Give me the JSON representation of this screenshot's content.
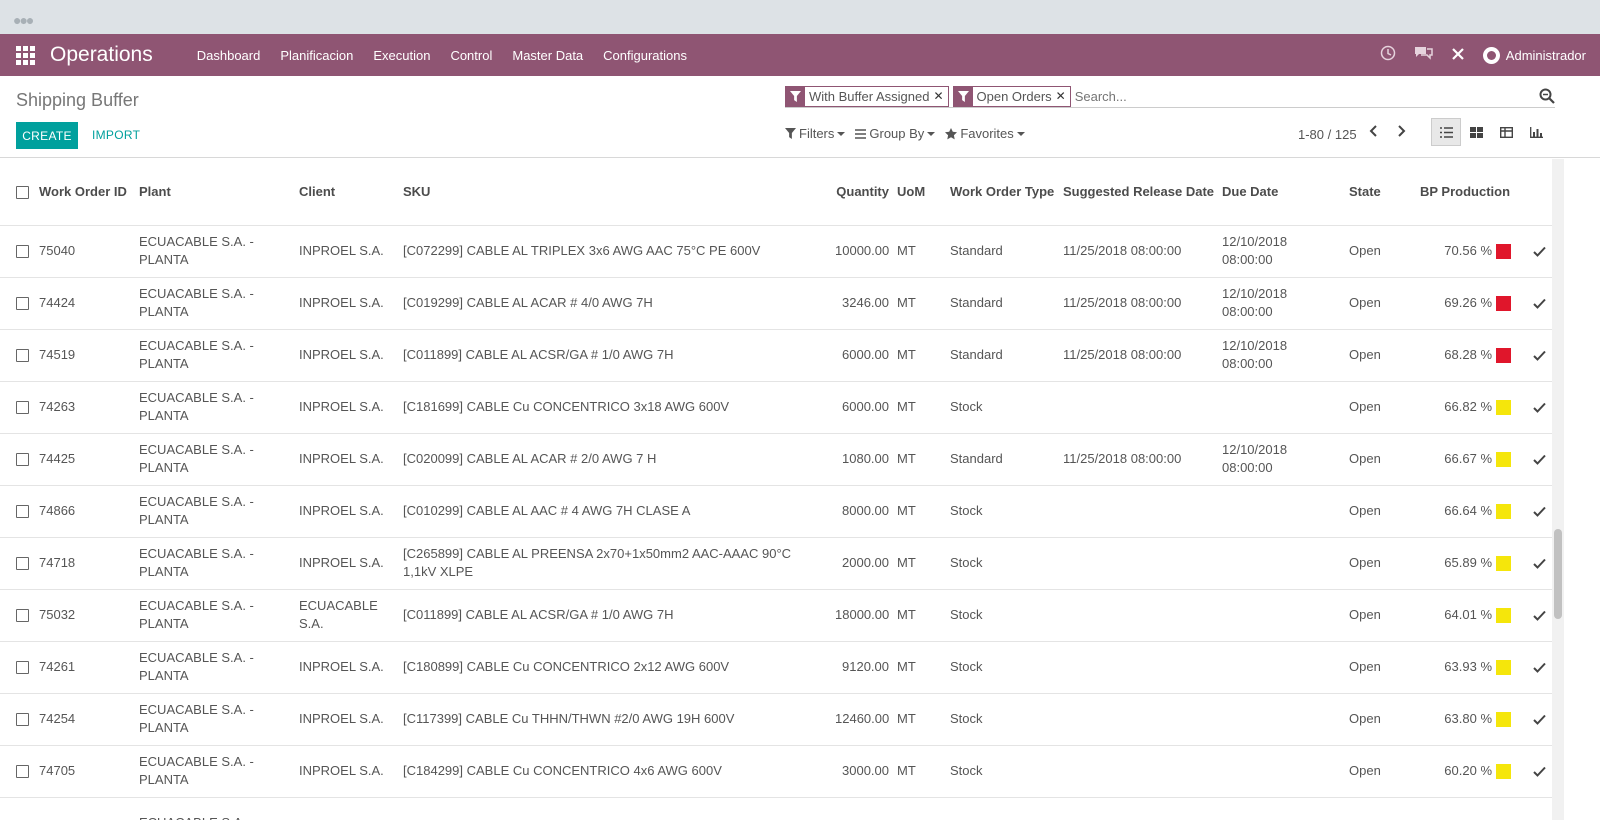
{
  "navbar": {
    "brand": "Operations",
    "menu": [
      "Dashboard",
      "Planificacion",
      "Execution",
      "Control",
      "Master Data",
      "Configurations"
    ],
    "user": "Administrador"
  },
  "cpanel": {
    "breadcrumb": "Shipping Buffer",
    "create_label": "CREATE",
    "import_label": "IMPORT",
    "facets": [
      "With Buffer Assigned",
      "Open Orders"
    ],
    "search_placeholder": "Search...",
    "filters_label": "Filters",
    "groupby_label": "Group By",
    "favorites_label": "Favorites",
    "pager": "1-80 / 125"
  },
  "table": {
    "headers": {
      "work_order_id": "Work Order ID",
      "plant": "Plant",
      "client": "Client",
      "sku": "SKU",
      "quantity": "Quantity",
      "uom": "UoM",
      "work_order_type": "Work Order Type",
      "suggested_release": "Suggested Release Date",
      "due_date": "Due Date",
      "state": "State",
      "bp_production": "BP Production"
    },
    "rows": [
      {
        "id": "75040",
        "plant": "ECUACABLE S.A. - PLANTA",
        "client": "INPROEL S.A.",
        "sku": "[C072299] CABLE AL TRIPLEX 3x6 AWG AAC 75°C PE 600V",
        "qty": "10000.00",
        "uom": "MT",
        "type": "Standard",
        "release": "11/25/2018 08:00:00",
        "due": "12/10/2018 08:00:00",
        "state": "Open",
        "bp": "70.56 %",
        "color": "#e0162b"
      },
      {
        "id": "74424",
        "plant": "ECUACABLE S.A. - PLANTA",
        "client": "INPROEL S.A.",
        "sku": "[C019299] CABLE AL ACAR # 4/0 AWG 7H",
        "qty": "3246.00",
        "uom": "MT",
        "type": "Standard",
        "release": "11/25/2018 08:00:00",
        "due": "12/10/2018 08:00:00",
        "state": "Open",
        "bp": "69.26 %",
        "color": "#e0162b"
      },
      {
        "id": "74519",
        "plant": "ECUACABLE S.A. - PLANTA",
        "client": "INPROEL S.A.",
        "sku": "[C011899] CABLE AL ACSR/GA # 1/0 AWG 7H",
        "qty": "6000.00",
        "uom": "MT",
        "type": "Standard",
        "release": "11/25/2018 08:00:00",
        "due": "12/10/2018 08:00:00",
        "state": "Open",
        "bp": "68.28 %",
        "color": "#e0162b"
      },
      {
        "id": "74263",
        "plant": "ECUACABLE S.A. - PLANTA",
        "client": "INPROEL S.A.",
        "sku": "[C181699] CABLE Cu CONCENTRICO 3x18 AWG 600V",
        "qty": "6000.00",
        "uom": "MT",
        "type": "Stock",
        "release": "",
        "due": "",
        "state": "Open",
        "bp": "66.82 %",
        "color": "#f5e60b"
      },
      {
        "id": "74425",
        "plant": "ECUACABLE S.A. - PLANTA",
        "client": "INPROEL S.A.",
        "sku": "[C020099] CABLE AL ACAR # 2/0 AWG 7 H",
        "qty": "1080.00",
        "uom": "MT",
        "type": "Standard",
        "release": "11/25/2018 08:00:00",
        "due": "12/10/2018 08:00:00",
        "state": "Open",
        "bp": "66.67 %",
        "color": "#f5e60b"
      },
      {
        "id": "74866",
        "plant": "ECUACABLE S.A. - PLANTA",
        "client": "INPROEL S.A.",
        "sku": "[C010299] CABLE AL AAC # 4 AWG 7H CLASE A",
        "qty": "8000.00",
        "uom": "MT",
        "type": "Stock",
        "release": "",
        "due": "",
        "state": "Open",
        "bp": "66.64 %",
        "color": "#f5e60b"
      },
      {
        "id": "74718",
        "plant": "ECUACABLE S.A. - PLANTA",
        "client": "INPROEL S.A.",
        "sku": "[C265899] CABLE AL PREENSA 2x70+1x50mm2 AAC-AAAC 90°C 1,1kV XLPE",
        "qty": "2000.00",
        "uom": "MT",
        "type": "Stock",
        "release": "",
        "due": "",
        "state": "Open",
        "bp": "65.89 %",
        "color": "#f5e60b"
      },
      {
        "id": "75032",
        "plant": "ECUACABLE S.A. - PLANTA",
        "client": "ECUACABLE S.A.",
        "sku": "[C011899] CABLE AL ACSR/GA # 1/0 AWG 7H",
        "qty": "18000.00",
        "uom": "MT",
        "type": "Stock",
        "release": "",
        "due": "",
        "state": "Open",
        "bp": "64.01 %",
        "color": "#f5e60b"
      },
      {
        "id": "74261",
        "plant": "ECUACABLE S.A. - PLANTA",
        "client": "INPROEL S.A.",
        "sku": "[C180899] CABLE Cu CONCENTRICO 2x12 AWG 600V",
        "qty": "9120.00",
        "uom": "MT",
        "type": "Stock",
        "release": "",
        "due": "",
        "state": "Open",
        "bp": "63.93 %",
        "color": "#f5e60b"
      },
      {
        "id": "74254",
        "plant": "ECUACABLE S.A. - PLANTA",
        "client": "INPROEL S.A.",
        "sku": "[C117399] CABLE Cu THHN/THWN #2/0 AWG 19H 600V",
        "qty": "12460.00",
        "uom": "MT",
        "type": "Stock",
        "release": "",
        "due": "",
        "state": "Open",
        "bp": "63.80 %",
        "color": "#f5e60b"
      },
      {
        "id": "74705",
        "plant": "ECUACABLE S.A. - PLANTA",
        "client": "INPROEL S.A.",
        "sku": "[C184299] CABLE Cu CONCENTRICO 4x6 AWG 600V",
        "qty": "3000.00",
        "uom": "MT",
        "type": "Stock",
        "release": "",
        "due": "",
        "state": "Open",
        "bp": "60.20 %",
        "color": "#f5e60b"
      },
      {
        "id": "",
        "plant": "ECUACABLE S.A.",
        "client": "",
        "sku": "",
        "qty": "",
        "uom": "",
        "type": "",
        "release": "",
        "due": "",
        "state": "",
        "bp": "",
        "color": ""
      }
    ]
  }
}
